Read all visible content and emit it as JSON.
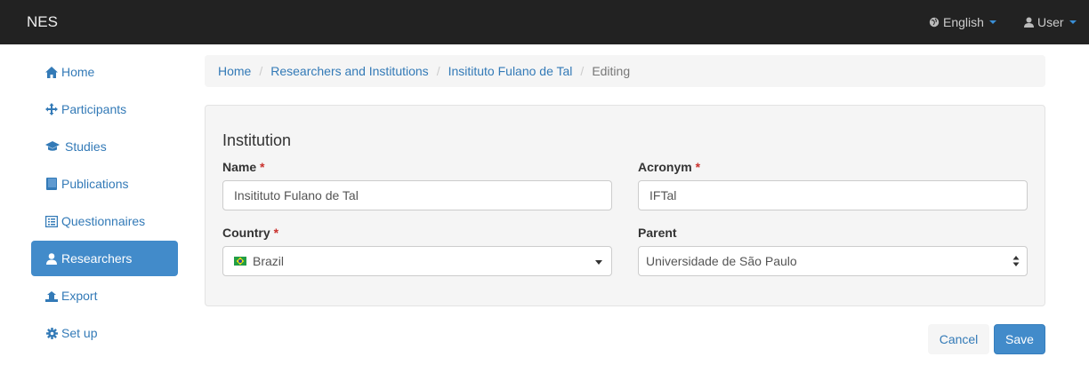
{
  "navbar": {
    "brand": "NES",
    "language": "English",
    "user": "User"
  },
  "sidebar": {
    "items": [
      {
        "label": "Home",
        "icon": "home-icon"
      },
      {
        "label": "Participants",
        "icon": "move-icon"
      },
      {
        "label": "Studies",
        "icon": "graduation-cap-icon"
      },
      {
        "label": "Publications",
        "icon": "book-icon"
      },
      {
        "label": "Questionnaires",
        "icon": "list-alt-icon"
      },
      {
        "label": "Researchers",
        "icon": "user-icon",
        "active": true
      },
      {
        "label": "Export",
        "icon": "export-icon"
      },
      {
        "label": "Set up",
        "icon": "cog-icon"
      }
    ]
  },
  "breadcrumb": {
    "home": "Home",
    "researchers": "Researchers and Institutions",
    "institution": "Insitituto Fulano de Tal",
    "current": "Editing"
  },
  "form": {
    "title": "Institution",
    "name_label": "Name",
    "name_value": "Insitituto Fulano de Tal",
    "acronym_label": "Acronym",
    "acronym_value": "IFTal",
    "country_label": "Country",
    "country_value": "Brazil",
    "parent_label": "Parent",
    "parent_value": "Universidade de São Paulo",
    "required_mark": "*"
  },
  "actions": {
    "cancel": "Cancel",
    "save": "Save"
  },
  "colors": {
    "navbar": "#222222",
    "primary": "#428bca",
    "link": "#337ab7",
    "required": "#c9302c"
  }
}
